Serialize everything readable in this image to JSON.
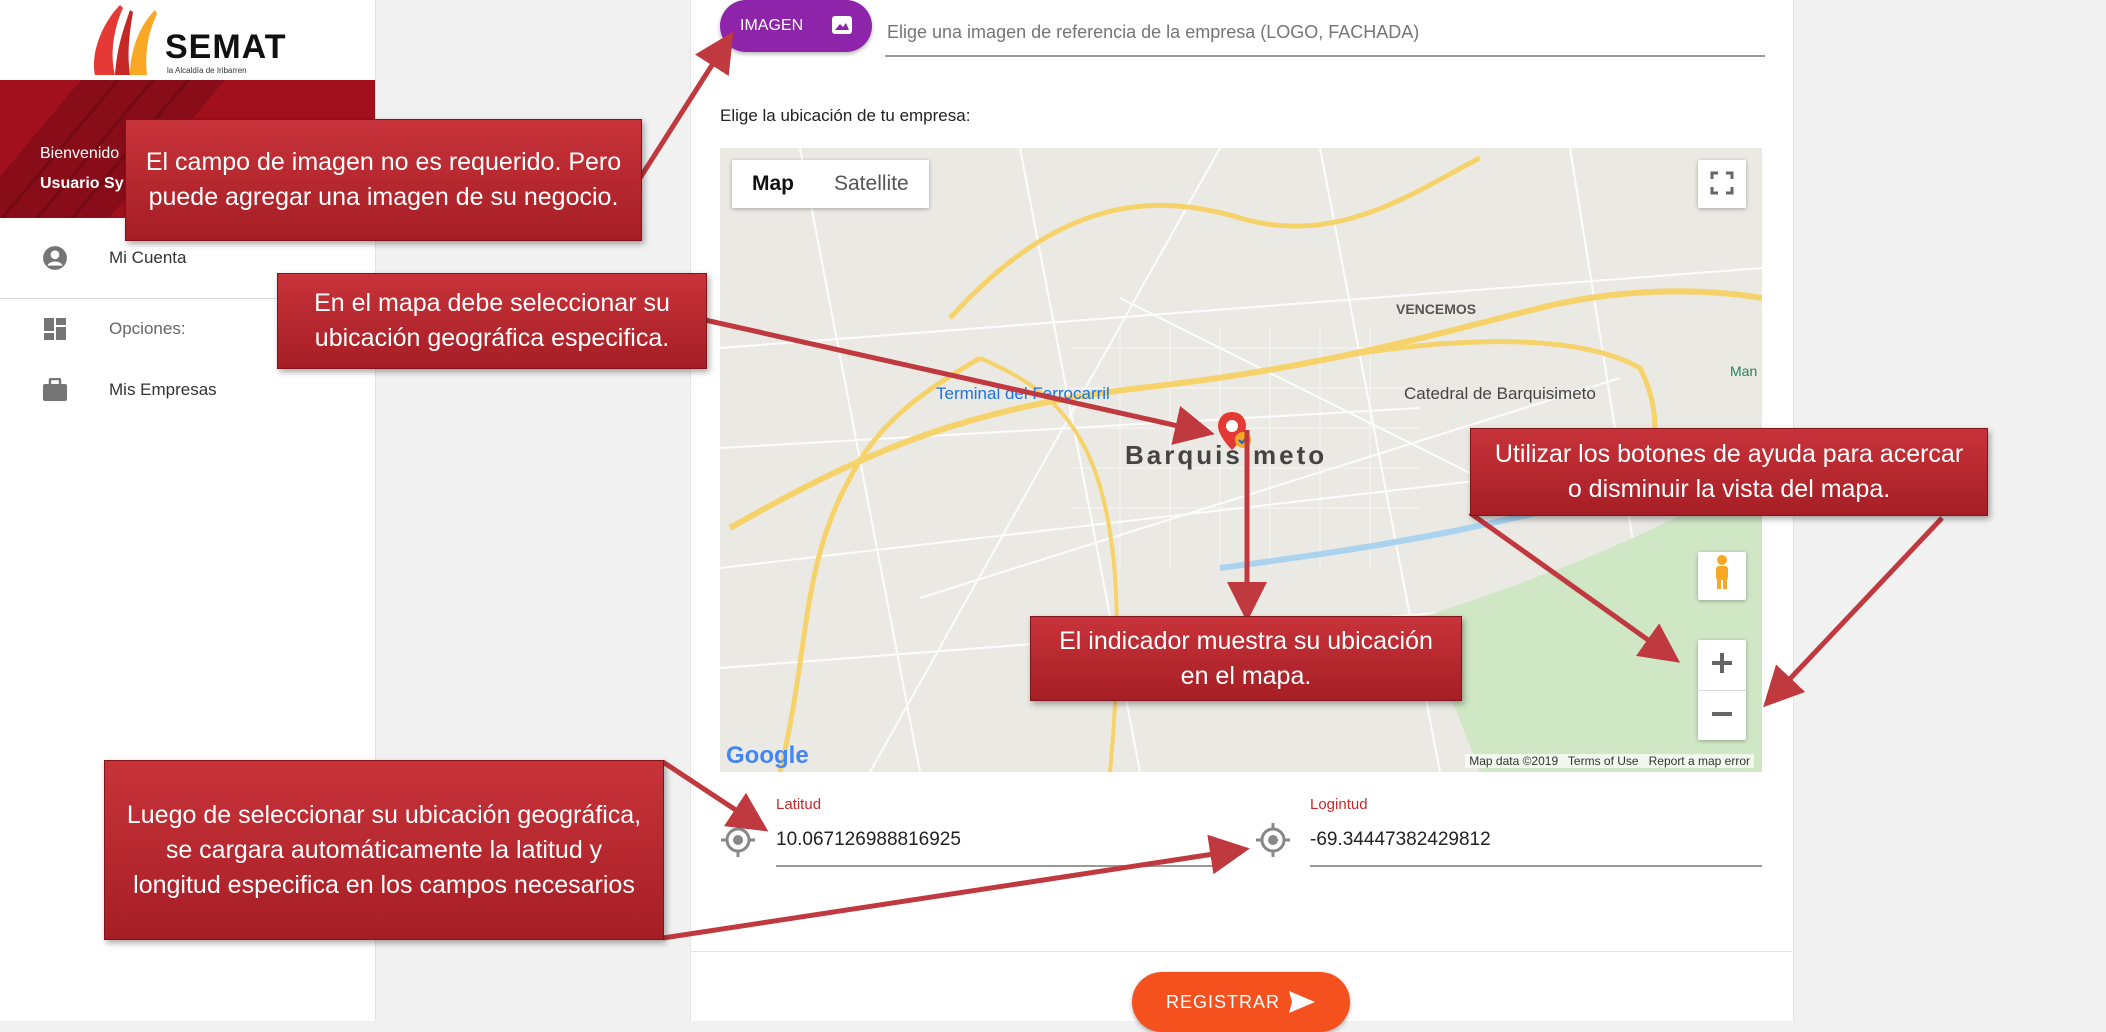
{
  "app": {
    "logo_text": "SEMAT",
    "logo_subtext": "la Alcaldía de Iribarren"
  },
  "sidebar": {
    "welcome": "Bienvenido",
    "username": "Usuario Sy",
    "items": [
      {
        "label": "Mi Cuenta",
        "icon": "account-circle-icon"
      },
      {
        "label": "Opciones:",
        "icon": "dashboard-icon"
      },
      {
        "label": "Mis Empresas",
        "icon": "briefcase-icon"
      }
    ]
  },
  "form": {
    "image_button": "IMAGEN",
    "image_placeholder": "Elige una imagen de referencia de la empresa (LOGO, FACHADA)",
    "location_label": "Elige la ubicación de tu empresa:",
    "latitude_label": "Latitud",
    "latitude_value": "10.067126988816925",
    "longitude_label": "Logintud",
    "longitude_value": "-69.34447382429812",
    "submit_label": "REGISTRAR"
  },
  "map": {
    "type_map": "Map",
    "type_satellite": "Satellite",
    "city": "Barquisimeto",
    "labels": {
      "vencemos": "VENCEMOS",
      "terminal": "Terminal del Ferrocarril",
      "catedral": "Catedral de Barquisimeto",
      "man": "Man"
    },
    "footer": {
      "data": "Map data ©2019",
      "terms": "Terms of Use",
      "report": "Report a map error"
    },
    "google": "Google"
  },
  "callouts": {
    "image": "El campo de imagen no es requerido. Pero puede agregar una imagen de su negocio.",
    "map": "En el mapa debe seleccionar su ubicación geográfica especifica.",
    "zoom": "Utilizar los botones de ayuda para acercar o disminuir la vista del mapa.",
    "marker": "El indicador muestra su ubicación en el mapa.",
    "coords": "Luego de seleccionar su ubicación geográfica, se cargara automáticamente la latitud y longitud especifica en los campos necesarios"
  },
  "colors": {
    "accent_purple": "#8e24aa",
    "accent_orange": "#f4511e",
    "brand_red": "#a2101d",
    "callout_red": "#c8333a"
  }
}
